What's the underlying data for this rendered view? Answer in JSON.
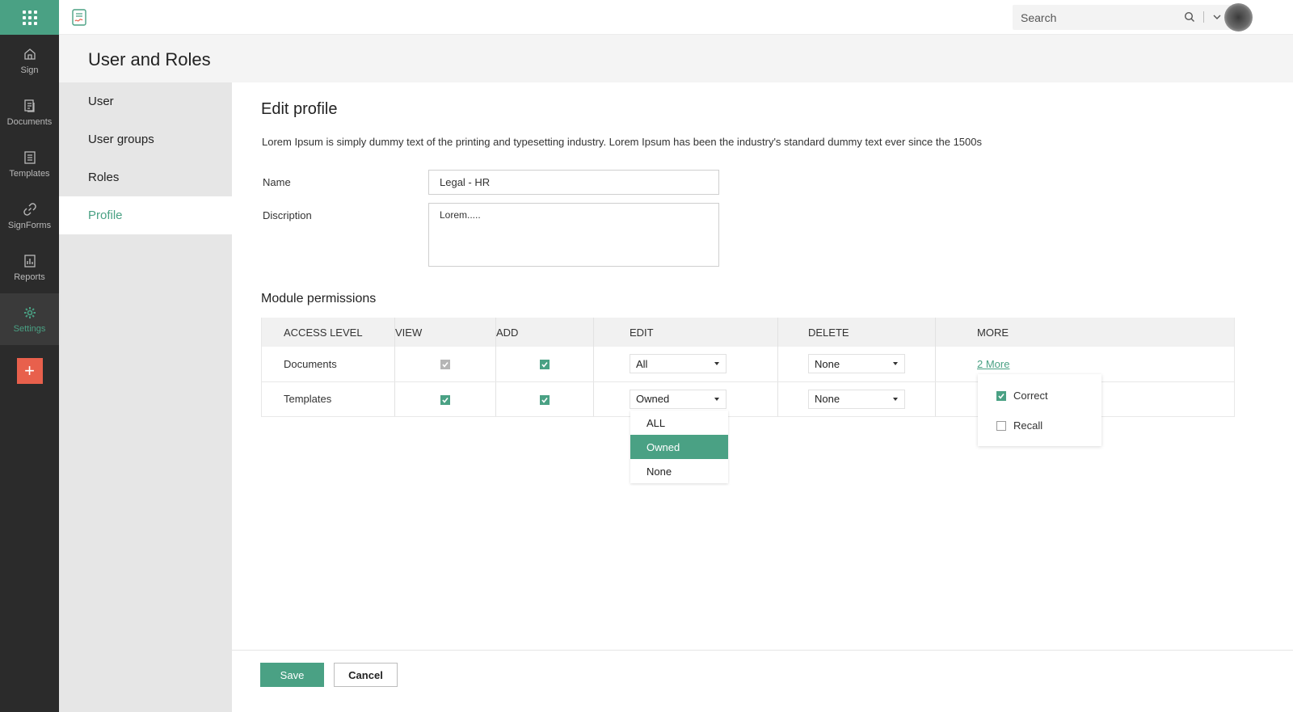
{
  "rail": {
    "items": [
      {
        "label": "Sign",
        "icon": "home-icon"
      },
      {
        "label": "Documents",
        "icon": "documents-icon"
      },
      {
        "label": "Templates",
        "icon": "templates-icon"
      },
      {
        "label": "SignForms",
        "icon": "link-icon"
      },
      {
        "label": "Reports",
        "icon": "reports-icon"
      },
      {
        "label": "Settings",
        "icon": "gear-icon",
        "active": true
      }
    ],
    "plus": "+"
  },
  "topbar": {
    "search_placeholder": "Search"
  },
  "page": {
    "title": "User and Roles"
  },
  "subnav": {
    "items": [
      "User",
      "User groups",
      "Roles",
      "Profile"
    ],
    "active": "Profile"
  },
  "form": {
    "title": "Edit profile",
    "description": "Lorem Ipsum is simply dummy text of the printing and typesetting industry. Lorem Ipsum has been the industry's standard dummy text ever since the 1500s",
    "name_label": "Name",
    "name_value": "Legal - HR",
    "desc_label": "Discription",
    "desc_value": "Lorem....."
  },
  "permissions": {
    "title": "Module permissions",
    "headers": [
      "ACCESS LEVEL",
      "VIEW",
      "ADD",
      "EDIT",
      "DELETE",
      "MORE"
    ],
    "rows": [
      {
        "module": "Documents",
        "view": "checked-disabled",
        "add": "checked",
        "edit": "All",
        "delete": "None",
        "more": "2 More"
      },
      {
        "module": "Templates",
        "view": "checked",
        "add": "checked",
        "edit": "Owned",
        "delete": "None",
        "more": ""
      }
    ]
  },
  "edit_dropdown": {
    "options": [
      "ALL",
      "Owned",
      "None"
    ],
    "selected": "Owned"
  },
  "more_popover": {
    "options": [
      {
        "label": "Correct",
        "checked": true
      },
      {
        "label": "Recall",
        "checked": false
      }
    ]
  },
  "footer": {
    "save": "Save",
    "cancel": "Cancel"
  },
  "colors": {
    "accent": "#4aa184",
    "rail_bg": "#2b2b2b",
    "plus_btn": "#e8604c"
  }
}
